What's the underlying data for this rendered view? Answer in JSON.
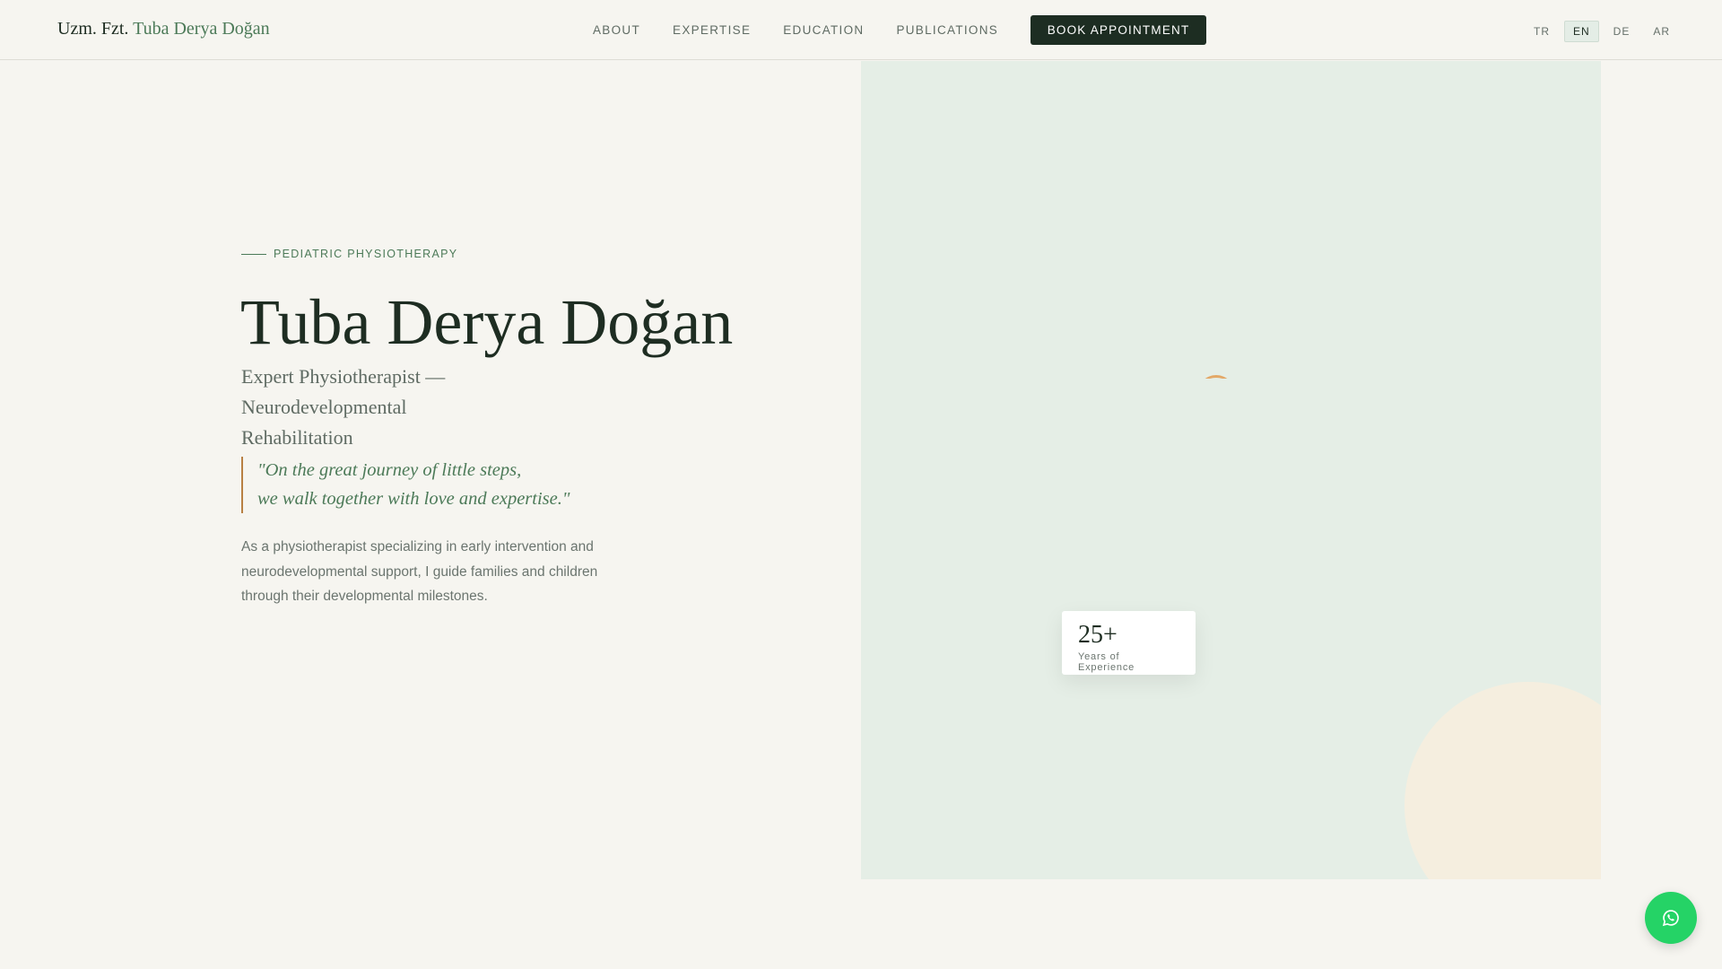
{
  "header": {
    "logo_prefix": "Uzm. Fzt.",
    "logo_name": "Tuba Derya Doğan",
    "nav": [
      "ABOUT",
      "EXPERTISE",
      "EDUCATION",
      "PUBLICATIONS"
    ],
    "book_label": "BOOK APPOINTMENT",
    "languages": [
      "TR",
      "EN",
      "DE",
      "AR"
    ],
    "active_language": "EN"
  },
  "hero": {
    "tag": "PEDIATRIC PHYSIOTHERAPY",
    "title": "Tuba Derya Doğan",
    "subtitle_line1": "Expert Physiotherapist —",
    "subtitle_line2": "Neurodevelopmental Rehabilitation",
    "quote_line1": "\"On the great journey of little steps,",
    "quote_line2": "we walk together with love and expertise.\"",
    "body": "As a physiotherapist specializing in early intervention and neurodevelopmental support, I guide families and children through their developmental milestones."
  },
  "stat": {
    "value": "25+",
    "label": "Years of Experience"
  },
  "colors": {
    "accent": "#4c7a58",
    "dark": "#1d2d22",
    "whatsapp": "#25d366"
  }
}
